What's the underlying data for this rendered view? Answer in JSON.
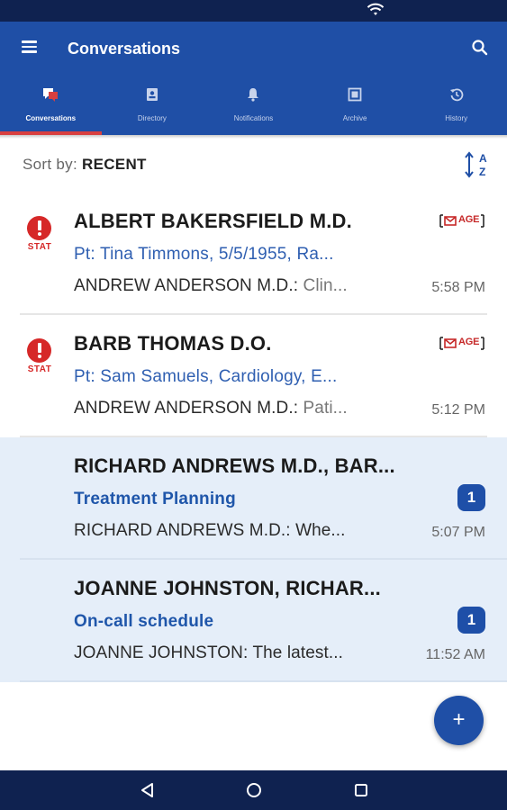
{
  "status_bar": {
    "wifi_icon": "wifi-icon"
  },
  "app_bar": {
    "title": "Conversations",
    "menu_icon": "hamburger-menu-icon",
    "search_icon": "search-icon",
    "background": "#1f4fa6"
  },
  "tabs": [
    {
      "label": "Conversations",
      "icon": "chat-icon",
      "active": true
    },
    {
      "label": "Directory",
      "icon": "contact-card-icon",
      "active": false
    },
    {
      "label": "Notifications",
      "icon": "bell-icon",
      "active": false
    },
    {
      "label": "Archive",
      "icon": "archive-box-icon",
      "active": false
    },
    {
      "label": "History",
      "icon": "history-icon",
      "active": false
    }
  ],
  "sort": {
    "label": "Sort by:",
    "value": "RECENT",
    "icon": "sort-az-icon"
  },
  "conversations": [
    {
      "name": "ALBERT BAKERSFIELD M.D.",
      "subject": "Pt: Tina Timmons, 5/5/1955, Ra...",
      "preview_sender": "ANDREW ANDERSON M.D.:",
      "preview_text": "Clin...",
      "time": "5:58 PM",
      "stat": true,
      "stat_label": "STAT",
      "image_badge": "AGE",
      "unread_count": null
    },
    {
      "name": "BARB THOMAS D.O.",
      "subject": "Pt: Sam Samuels, Cardiology, E...",
      "preview_sender": "ANDREW ANDERSON M.D.:",
      "preview_text": "Pati...",
      "time": "5:12 PM",
      "stat": true,
      "stat_label": "STAT",
      "image_badge": "AGE",
      "unread_count": null
    },
    {
      "name": "RICHARD ANDREWS M.D., BAR...",
      "subject": "Treatment Planning",
      "preview_sender": "RICHARD ANDREWS M.D.:",
      "preview_text": "Whe...",
      "time": "5:07 PM",
      "stat": false,
      "unread_count": "1"
    },
    {
      "name": "JOANNE JOHNSTON, RICHAR...",
      "subject": "On-call schedule",
      "preview_sender": "JOANNE JOHNSTON:",
      "preview_text": "The latest...",
      "time": "11:52 AM",
      "stat": false,
      "unread_count": "1"
    }
  ],
  "fab": {
    "label": "+",
    "icon": "add-icon"
  },
  "nav_bar": {
    "back_icon": "back-triangle-icon",
    "home_icon": "home-circle-icon",
    "recents_icon": "recents-square-icon"
  },
  "colors": {
    "accent": "#1f4fa6",
    "stat_red": "#d62828",
    "unread_bg": "#e5eef9",
    "tab_indicator": "#d84040"
  }
}
